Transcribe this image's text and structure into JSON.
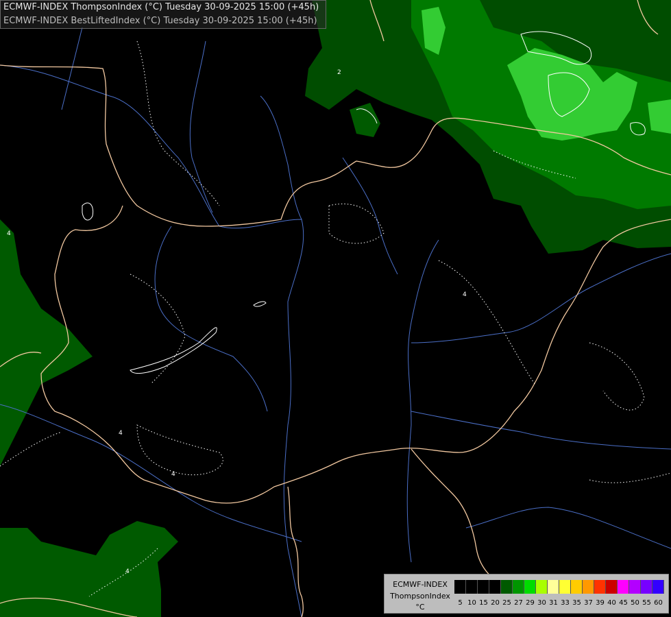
{
  "header": {
    "line1": "ECMWF-INDEX ThompsonIndex (°C) Tuesday 30-09-2025 15:00 (+45h)",
    "line2": "ECMWF-INDEX BestLiftedIndex (°C) Tuesday 30-09-2025 15:00 (+45h)"
  },
  "legend": {
    "name_line1": "ECMWF-INDEX",
    "name_line2": "ThompsonIndex",
    "unit": "°C",
    "colors": [
      "#000000",
      "#000000",
      "#000000",
      "#000000",
      "#005a00",
      "#009600",
      "#00dc00",
      "#aaff00",
      "#ffff99",
      "#ffff33",
      "#ffcc00",
      "#ff9900",
      "#ff3300",
      "#cc0000",
      "#ff00ff",
      "#b300ff",
      "#7700ff",
      "#3300ff"
    ],
    "ticks": [
      "5",
      "10",
      "15",
      "20",
      "25",
      "27",
      "29",
      "30",
      "31",
      "33",
      "35",
      "37",
      "39",
      "40",
      "45",
      "50",
      "55",
      "60"
    ]
  },
  "contour_labels": [
    "2",
    "4",
    "4",
    "4",
    "4",
    "4"
  ],
  "colors": {
    "dark_green": "#004d00",
    "mid_green": "#007a00",
    "light_green": "#33cc33",
    "border": "#f2c8a0",
    "river": "#4b6fc8",
    "lifted_contour": "#ffffff"
  }
}
